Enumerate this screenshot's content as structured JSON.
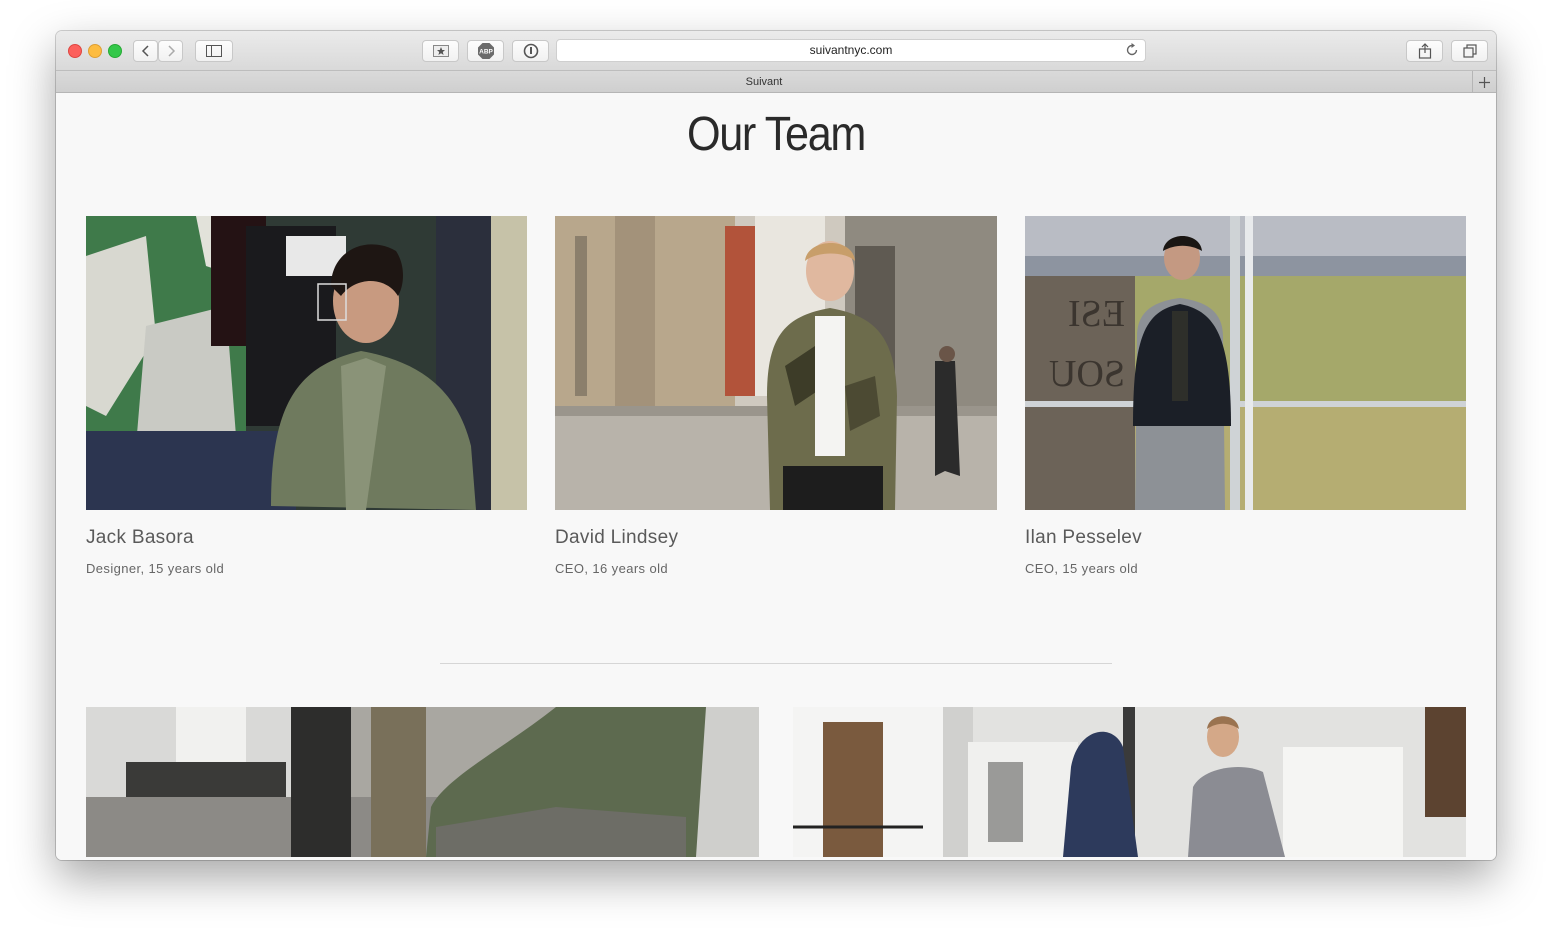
{
  "browser": {
    "url": "suivantnyc.com",
    "tab_title": "Suivant",
    "icons": {
      "back": "chevron-left-icon",
      "forward": "chevron-right-icon",
      "sidebar": "sidebar-icon",
      "bookmark": "star-icon",
      "adblock": "abp-icon",
      "password": "password-icon",
      "reload": "reload-icon",
      "share": "share-icon",
      "tabs": "tabs-icon",
      "new_tab": "plus-icon"
    },
    "adblock_label": "ABP"
  },
  "page": {
    "title": "Our Team",
    "members": [
      {
        "name": "Jack Basora",
        "role": "Designer, 15 years old"
      },
      {
        "name": "David Lindsey",
        "role": "CEO, 16 years old"
      },
      {
        "name": "Ilan Pesselev",
        "role": "CEO, 15 years old"
      }
    ]
  },
  "colors": {
    "page_bg": "#f8f8f8",
    "title_text": "#2a2a2a",
    "name_text": "#5a5a5a",
    "divider": "#d6d6d6"
  }
}
